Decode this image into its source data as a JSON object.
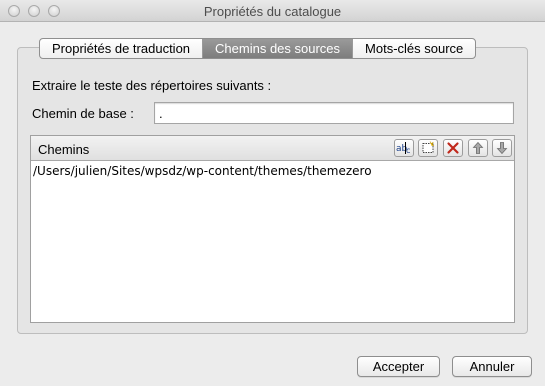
{
  "window": {
    "title": "Propriétés du catalogue"
  },
  "tabs": [
    {
      "label": "Propriétés de traduction",
      "active": false
    },
    {
      "label": "Chemins des sources",
      "active": true
    },
    {
      "label": "Mots-clés source",
      "active": false
    }
  ],
  "sources": {
    "intro_text": "Extraire le teste des répertoires suivants :",
    "base_path_label": "Chemin de base :",
    "base_path_value": ".",
    "paths_header": "Chemins",
    "paths": [
      "/Users/julien/Sites/wpsdz/wp-content/themes/themezero"
    ],
    "toolbar_icons": [
      "edit-text-icon",
      "new-item-icon",
      "delete-icon",
      "arrow-up-icon",
      "arrow-down-icon"
    ]
  },
  "buttons": {
    "ok_label": "Accepter",
    "cancel_label": "Annuler"
  },
  "colors": {
    "active_tab": "#8a8a8a",
    "delete_icon": "#c0281c"
  }
}
